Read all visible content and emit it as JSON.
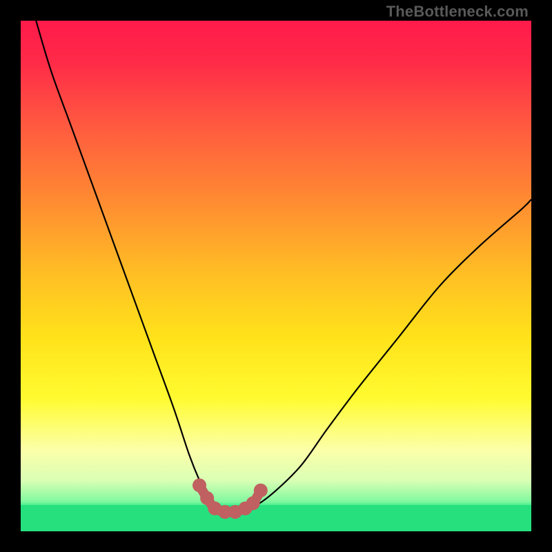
{
  "watermark": "TheBottleneck.com",
  "colors": {
    "frame": "#000000",
    "curve_stroke": "#000000",
    "accent_fill": "#c06060",
    "accent_stroke": "#c06060",
    "green_band": "#26e07e",
    "gradient_stops": [
      {
        "offset": 0.0,
        "color": "#ff1a4a"
      },
      {
        "offset": 0.08,
        "color": "#ff2a48"
      },
      {
        "offset": 0.2,
        "color": "#ff5840"
      },
      {
        "offset": 0.35,
        "color": "#ff8a32"
      },
      {
        "offset": 0.5,
        "color": "#ffc024"
      },
      {
        "offset": 0.62,
        "color": "#ffe21a"
      },
      {
        "offset": 0.74,
        "color": "#fffb30"
      },
      {
        "offset": 0.84,
        "color": "#fcffa8"
      },
      {
        "offset": 0.9,
        "color": "#daffb4"
      },
      {
        "offset": 0.942,
        "color": "#80f8a0"
      },
      {
        "offset": 0.952,
        "color": "#2fe884"
      },
      {
        "offset": 0.965,
        "color": "#28e07e"
      },
      {
        "offset": 1.0,
        "color": "#28e07e"
      }
    ]
  },
  "chart_data": {
    "type": "line",
    "title": "",
    "xlabel": "",
    "ylabel": "",
    "xlim": [
      0,
      100
    ],
    "ylim": [
      0,
      100
    ],
    "series": [
      {
        "name": "bottleneck-curve",
        "x": [
          3,
          6,
          10,
          14,
          18,
          22,
          26,
          30,
          33,
          35,
          37,
          39,
          41,
          43,
          46,
          50,
          55,
          60,
          66,
          74,
          82,
          90,
          98,
          100
        ],
        "values": [
          100,
          90,
          79,
          68,
          57,
          46,
          35,
          24,
          15,
          10,
          6,
          4,
          4,
          4,
          5,
          8,
          13,
          20,
          28,
          38,
          48,
          56,
          63,
          65
        ]
      }
    ],
    "accent_segment": {
      "name": "valley-highlight",
      "x": [
        35.0,
        36.5,
        38.0,
        40.0,
        42.0,
        44.0,
        45.5,
        47.0
      ],
      "values": [
        9.0,
        6.5,
        4.5,
        3.8,
        3.8,
        4.5,
        5.5,
        8.0
      ]
    },
    "accent_dots": {
      "x": [
        35.0,
        36.5,
        38.0,
        40.0,
        42.0,
        44.0,
        45.5,
        47.0
      ],
      "values": [
        9.0,
        6.5,
        4.5,
        3.8,
        3.8,
        4.5,
        5.5,
        8.0
      ]
    },
    "annotations": []
  }
}
